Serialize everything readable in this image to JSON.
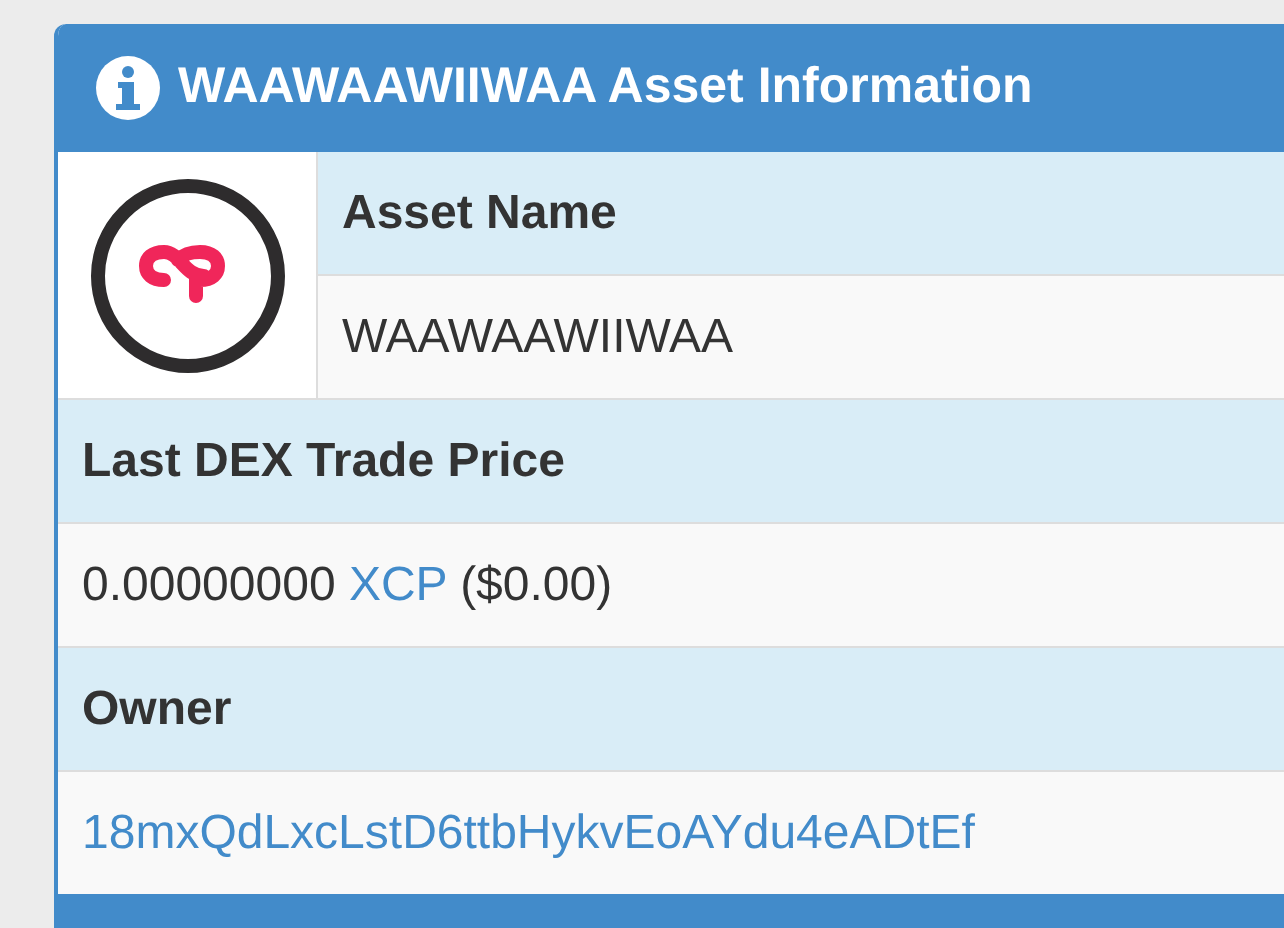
{
  "panel": {
    "title": "WAAWAAWIIWAA Asset Information"
  },
  "asset_name": {
    "label": "Asset Name",
    "value": "WAAWAAWIIWAA"
  },
  "last_dex_trade_price": {
    "label": "Last DEX Trade Price",
    "amount": "0.00000000",
    "currency": "XCP",
    "usd": "($0.00)"
  },
  "owner": {
    "label": "Owner",
    "address": "18mxQdLxcLstD6ttbHykvEoAYdu4eADtEf"
  }
}
